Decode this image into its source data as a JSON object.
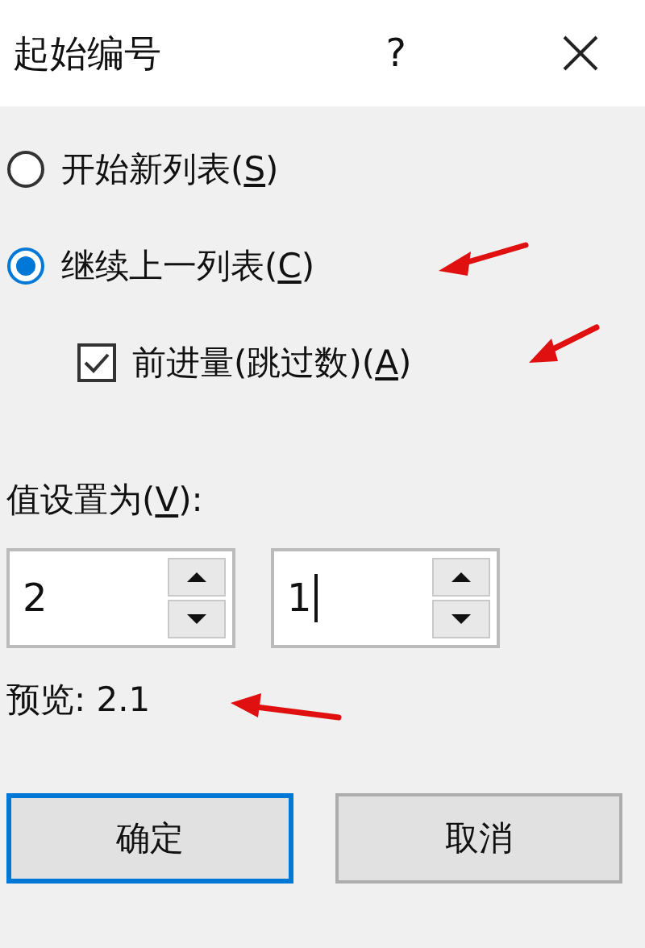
{
  "window": {
    "title": "起始编号",
    "help": "?"
  },
  "options": [
    {
      "kind": "radio",
      "before": "开始新列表(",
      "key": "S",
      "after": ")",
      "selected": false
    },
    {
      "kind": "radio",
      "before": "继续上一列表(",
      "key": "C",
      "after": ")",
      "selected": true
    },
    {
      "kind": "checkbox",
      "before": "前进量(跳过数)(",
      "key": "A",
      "after": ")",
      "checked": true
    }
  ],
  "value_label": {
    "before": "值设置为(",
    "key": "V",
    "after": "):"
  },
  "fields": [
    {
      "value": "2",
      "focused": false
    },
    {
      "value": "1",
      "focused": true
    }
  ],
  "preview": "预览: 2.1",
  "buttons": [
    {
      "label": "确定",
      "default": true
    },
    {
      "label": "取消",
      "default": false
    }
  ]
}
